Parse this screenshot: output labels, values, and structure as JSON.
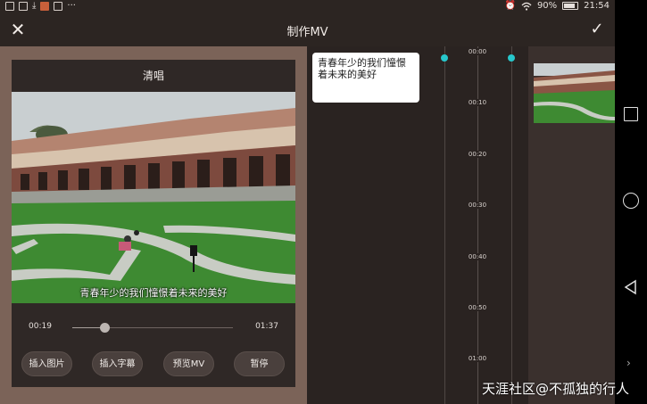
{
  "status_bar": {
    "battery": "90%",
    "time": "21:54",
    "icons": [
      "gallery-icon",
      "mail-icon",
      "download-icon",
      "app-icon",
      "app-icon",
      "more-icon",
      "alarm-icon",
      "wifi-icon",
      "battery-icon"
    ]
  },
  "header": {
    "title": "制作MV",
    "close_icon": "close-icon",
    "confirm_icon": "check-icon"
  },
  "player": {
    "mode_label": "清唱",
    "subtitle": "青春年少的我们憧憬着未来的美好",
    "time_current": "00:19",
    "time_total": "01:37",
    "progress_fraction": 0.2
  },
  "buttons": {
    "insert_image": "插入图片",
    "insert_subtitle": "插入字幕",
    "preview_mv": "预览MV",
    "pause": "暂停"
  },
  "subtitle_list": [
    {
      "text": "青春年少的我们憧憬着未来的美好"
    }
  ],
  "timeline": {
    "ticks": [
      "00:00",
      "00:10",
      "00:20",
      "00:30",
      "00:40",
      "00:50",
      "01:00"
    ],
    "accent": "#27c7cc"
  },
  "watermark": "天涯社区@不孤独的行人",
  "nav_icons": [
    "square-icon",
    "circle-icon",
    "back-triangle-icon",
    "chevron-right-icon"
  ]
}
